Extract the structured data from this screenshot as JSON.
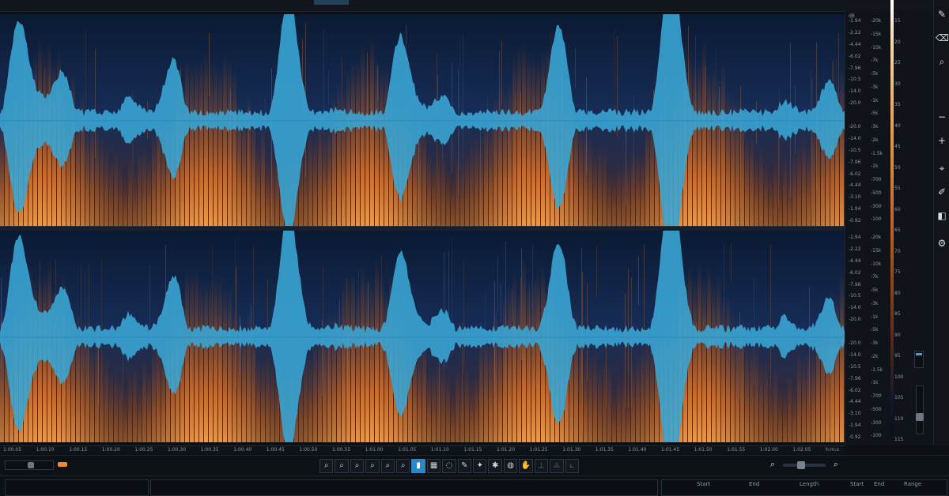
{
  "app": {
    "accent_blue": "#3aa7d6",
    "spectro_orange": "#f08a2a",
    "background": "#0b1a33"
  },
  "scale": {
    "db_header": "dB",
    "channel1": {
      "left_labels": [
        "-1.94",
        "-2.22",
        "-4.44",
        "-6.02",
        "-7.96",
        "-10.5",
        "-14.0",
        "-20.0",
        "",
        "-20.0",
        "-14.0",
        "-10.5",
        "-7.96",
        "-6.02",
        "-4.44",
        "-3.10",
        "-1.94",
        "-0.92"
      ],
      "mid_labels": [
        "-20k",
        "-15k",
        "-10k",
        "-7k",
        "-5k",
        "-3k",
        "-1k",
        "-5k",
        "-3k",
        "-2k",
        "-1.5k",
        "-1k",
        "-700",
        "-500",
        "-300",
        "-100"
      ]
    },
    "channel2": {
      "left_labels": [
        "-1.94",
        "-2.22",
        "-4.44",
        "-6.02",
        "-7.96",
        "-10.5",
        "-14.0",
        "-20.0",
        "",
        "-20.0",
        "-14.0",
        "-10.5",
        "-7.96",
        "-6.02",
        "-4.44",
        "-3.10",
        "-1.94",
        "-0.92"
      ],
      "mid_labels": [
        "-20k",
        "-15k",
        "-10k",
        "-7k",
        "-5k",
        "-3k",
        "-1k",
        "-5k",
        "-3k",
        "-2k",
        "-1.5k",
        "-1k",
        "-700",
        "-500",
        "-300",
        "-100"
      ]
    },
    "db_right": [
      "15",
      "20",
      "25",
      "30",
      "35",
      "40",
      "45",
      "50",
      "55",
      "60",
      "65",
      "70",
      "75",
      "80",
      "85",
      "90",
      "95",
      "100",
      "105",
      "110",
      "115"
    ]
  },
  "timeline": {
    "labels": [
      "1:00.05",
      "1:00.10",
      "1:00.15",
      "1:00.20",
      "1:00.25",
      "1:00.30",
      "1:00.35",
      "1:00.40",
      "1:00.45",
      "1:00.50",
      "1:00.55",
      "1:01.00",
      "1:01.05",
      "1:01.10",
      "1:01.15",
      "1:01.20",
      "1:01.25",
      "1:01.30",
      "1:01.35",
      "1:01.40",
      "1:01.45",
      "1:01.50",
      "1:01.55",
      "1:02.00",
      "1:02.05",
      "h:m:s"
    ]
  },
  "toolbar": {
    "icons": [
      "zoom-in-icon",
      "zoom-out-icon",
      "zoom-sel-icon",
      "zoom-full-icon",
      "zoom-prev-icon",
      "zoom-next-icon",
      "time-select-icon",
      "freq-select-icon",
      "lasso-icon",
      "brush-icon",
      "magic-wand-icon",
      "find-similar-icon",
      "grab-icon",
      "hand-icon",
      "disabled-1-icon",
      "disabled-2-icon",
      "disabled-3-icon"
    ],
    "glyphs": [
      "⌕",
      "⌕",
      "⌕",
      "⌕",
      "⌕",
      "⌕",
      "▮",
      "▦",
      "◌",
      "✎",
      "✦",
      "✱",
      "◍",
      "✋",
      "⟂",
      "⟁",
      "⟀"
    ]
  },
  "panel": {
    "headers": [
      "Start",
      "End",
      "Length",
      "Start",
      "End",
      "Range"
    ]
  },
  "right_icons": [
    "pencil-icon",
    "eraser-icon",
    "zoom-icon",
    "minus-icon",
    "plus-icon",
    "cursor-icon",
    "brush-icon",
    "fill-icon",
    "gear-icon"
  ]
}
